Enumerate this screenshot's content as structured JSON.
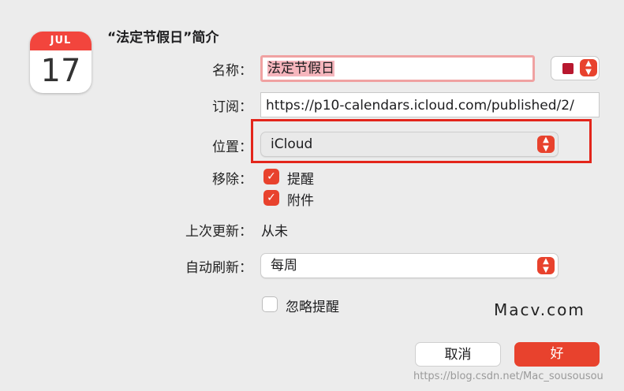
{
  "calendar_icon": {
    "month": "JUL",
    "day": "17"
  },
  "dialog": {
    "title": "“法定节假日”简介"
  },
  "fields": {
    "name_label": "名称：",
    "name_value": "法定节假日",
    "subscribe_label": "订阅：",
    "subscribe_value": "https://p10-calendars.icloud.com/published/2/",
    "location_label": "位置：",
    "location_value": "iCloud",
    "remove_label": "移除：",
    "remove_alerts_label": "提醒",
    "remove_attachments_label": "附件",
    "last_updated_label": "上次更新：",
    "last_updated_value": "从未",
    "auto_refresh_label": "自动刷新：",
    "auto_refresh_value": "每周",
    "ignore_alerts_label": "忽略提醒"
  },
  "checkboxes": {
    "remove_alerts": true,
    "remove_attachments": true,
    "ignore_alerts": false
  },
  "colors": {
    "calendar_color": "#b8182f",
    "accent": "#e8422d",
    "highlight_border": "#e3251b"
  },
  "buttons": {
    "cancel": "取消",
    "ok": "好"
  },
  "watermarks": {
    "overlay": "Macv.com",
    "footer": "https://blog.csdn.net/Mac_sousousou"
  },
  "icons": {
    "stepper": "chevron-up-down-icon",
    "check": "checkmark-icon"
  }
}
